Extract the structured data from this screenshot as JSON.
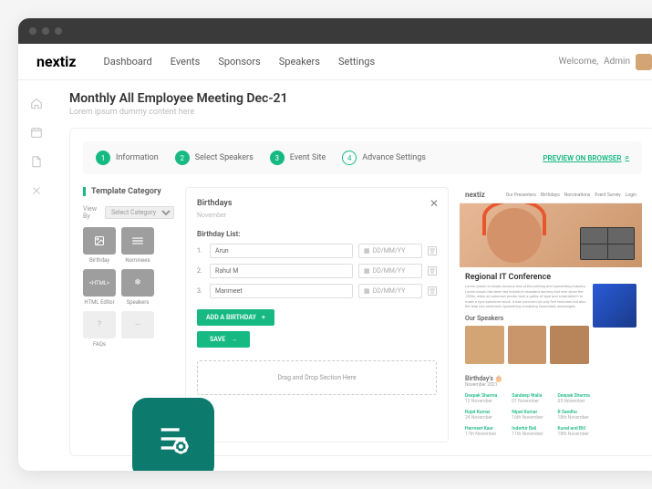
{
  "brand": "nextiz",
  "nav": {
    "items": [
      "Dashboard",
      "Events",
      "Sponsors",
      "Speakers",
      "Settings"
    ]
  },
  "welcome": {
    "label": "Welcome,",
    "user": "Admin"
  },
  "page": {
    "title": "Monthly All Employee Meeting Dec-21",
    "subtitle": "Lorem ipsum dummy content here"
  },
  "steps": [
    {
      "n": "1",
      "label": "Information"
    },
    {
      "n": "2",
      "label": "Select Speakers"
    },
    {
      "n": "3",
      "label": "Event Site"
    },
    {
      "n": "4",
      "label": "Advance Settings"
    }
  ],
  "preview_link": "PREVIEW ON BROWSER",
  "templates": {
    "header": "Template Category",
    "viewby": "View By",
    "select_placeholder": "Select Category",
    "tiles": [
      {
        "label": "Birthday",
        "icon": "image"
      },
      {
        "label": "Nominees",
        "icon": "list"
      },
      {
        "label": "HTML Editor",
        "icon": "html"
      },
      {
        "label": "Speakers",
        "icon": "snow"
      },
      {
        "label": "FAQs",
        "icon": "question"
      },
      {
        "label": "",
        "icon": "divider"
      }
    ]
  },
  "form": {
    "title": "Birthdays",
    "month": "November",
    "list_label": "Birthday List:",
    "date_placeholder": "DD/MM/YY",
    "rows": [
      {
        "n": "1.",
        "name": "Arun"
      },
      {
        "n": "2.",
        "name": "Rahul M"
      },
      {
        "n": "3.",
        "name": "Manmeet"
      }
    ],
    "add_btn": "ADD A BIRTHDAY",
    "save_btn": "SAVE",
    "dragzone": "Drag and Drop Section Here"
  },
  "preview": {
    "brand": "nextiz",
    "nav": [
      "Our Presenters",
      "Birthdays",
      "Nominations",
      "Event Survey",
      "Login"
    ],
    "conf_title": "Regional IT Conference",
    "conf_body": "Lorem Ipsum is simply dummy text of the printing and typesetting industry. Lorem Ipsum has been the industry's standard dummy text ever since the 1500s, when an unknown printer took a galley of type and scrambled it to make a type specimen book. It has survived not only five centuries but also the leap into electronic typesetting remaining essentially unchanged.",
    "speakers_title": "Our Speakers",
    "bday_title": "Birthday's 🎂",
    "bday_month": "November 2021",
    "bday_list": [
      [
        {
          "name": "Deepak Sharma",
          "date": "12 November"
        },
        {
          "name": "Rajat Kumar",
          "date": "24 November"
        },
        {
          "name": "Harmeet Kaur",
          "date": "17th November"
        }
      ],
      [
        {
          "name": "Sandeep Walla",
          "date": "01 November"
        },
        {
          "name": "Nipat Kumar",
          "date": "16th November"
        },
        {
          "name": "Inderbir Bali",
          "date": "11th November"
        }
      ],
      [
        {
          "name": "Deepak Sharma",
          "date": "05 November"
        },
        {
          "name": "R Sandhu",
          "date": "18th November"
        },
        {
          "name": "Kunal and Bill",
          "date": "18th November"
        }
      ]
    ]
  }
}
